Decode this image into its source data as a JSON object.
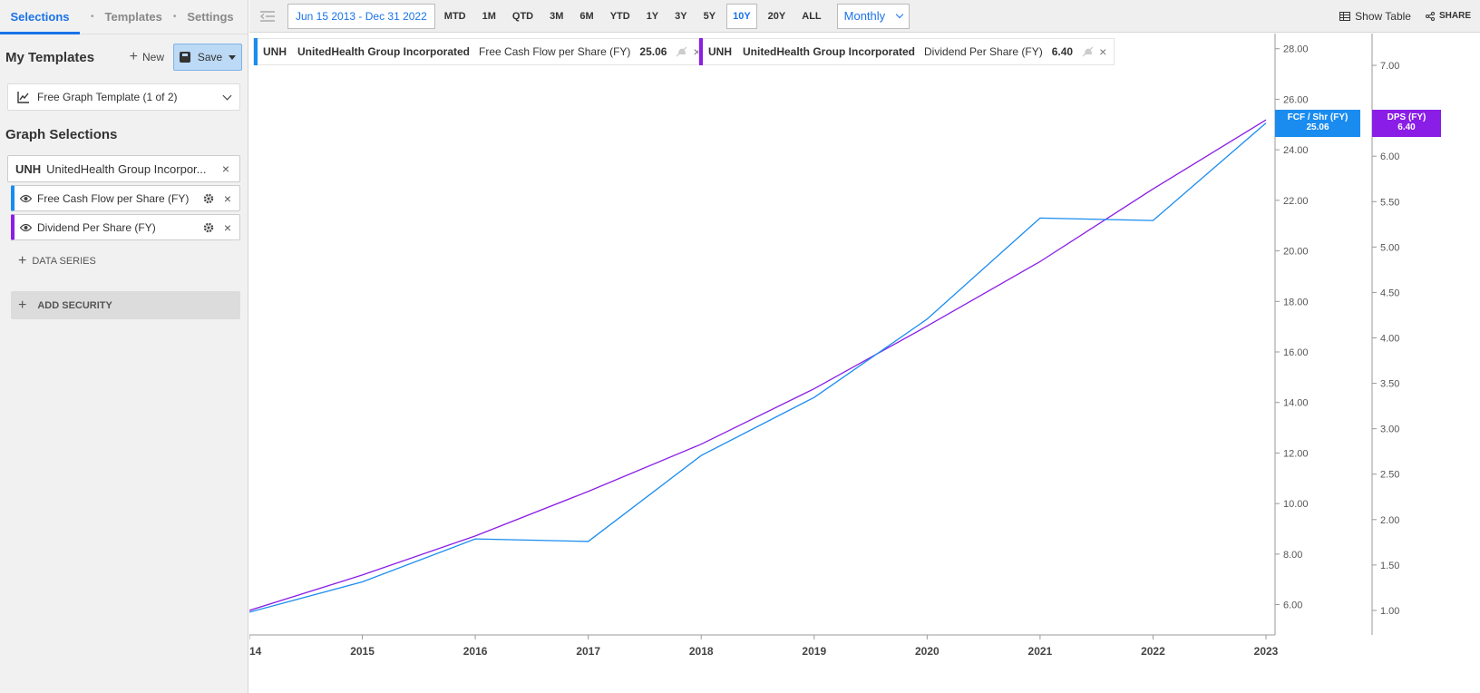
{
  "sidebar": {
    "tabs": [
      "Selections",
      "Templates",
      "Settings"
    ],
    "my_templates": "My Templates",
    "new_label": "New",
    "save_label": "Save",
    "template_select": "Free Graph Template (1 of 2)",
    "graph_selections": "Graph Selections",
    "security": {
      "ticker": "UNH",
      "name": "UnitedHealth Group Incorpor..."
    },
    "series": [
      {
        "label": "Free Cash Flow per Share (FY)",
        "color": "#1a8cf0"
      },
      {
        "label": "Dividend Per Share (FY)",
        "color": "#8a1ee6"
      }
    ],
    "add_data_series": "DATA SERIES",
    "add_security": "ADD SECURITY"
  },
  "toolbar": {
    "date_range": "Jun 15 2013 - Dec 31 2022",
    "periods": [
      "MTD",
      "1M",
      "QTD",
      "3M",
      "6M",
      "YTD",
      "1Y",
      "3Y",
      "5Y",
      "10Y",
      "20Y",
      "ALL"
    ],
    "active_period": "10Y",
    "frequency": "Monthly",
    "show_table": "Show Table",
    "share": "SHARE"
  },
  "legend": [
    {
      "ticker": "UNH",
      "name": "UnitedHealth Group Incorporated",
      "metric": "Free Cash Flow per Share (FY)",
      "value": "25.06",
      "color": "#1a8cf0"
    },
    {
      "ticker": "UNH",
      "name": "UnitedHealth Group Incorporated",
      "metric": "Dividend Per Share (FY)",
      "value": "6.40",
      "color": "#8a1ee6"
    }
  ],
  "badges": {
    "fcf": {
      "label": "FCF / Shr (FY)",
      "value": "25.06",
      "color": "#1a8cf0"
    },
    "dps": {
      "label": "DPS (FY)",
      "value": "6.40",
      "color": "#8a1ee6"
    }
  },
  "chart_data": {
    "type": "line",
    "x": [
      "14",
      "2015",
      "2016",
      "2017",
      "2018",
      "2019",
      "2020",
      "2021",
      "2022",
      "2023"
    ],
    "series": [
      {
        "name": "Free Cash Flow per Share (FY)",
        "axis": "left",
        "color": "#1a8cf0",
        "values": [
          5.7,
          6.9,
          8.6,
          8.5,
          11.9,
          14.2,
          17.3,
          21.3,
          21.2,
          25.06
        ]
      },
      {
        "name": "Dividend Per Share (FY)",
        "axis": "right",
        "color": "#8a1ee6",
        "values": [
          1.0,
          1.39,
          1.82,
          2.31,
          2.83,
          3.44,
          4.13,
          4.84,
          5.64,
          6.4
        ]
      }
    ],
    "left_axis": {
      "ticks": [
        "6.00",
        "8.00",
        "10.00",
        "12.00",
        "14.00",
        "16.00",
        "18.00",
        "20.00",
        "22.00",
        "24.00",
        "26.00",
        "28.00"
      ],
      "ylim": [
        4.8,
        28.6
      ]
    },
    "right_axis": {
      "ticks": [
        "1.00",
        "1.50",
        "2.00",
        "2.50",
        "3.00",
        "3.50",
        "4.00",
        "4.50",
        "5.00",
        "5.50",
        "6.00",
        "7.00"
      ],
      "ylim": [
        0.73,
        7.35
      ]
    },
    "grid": false
  }
}
